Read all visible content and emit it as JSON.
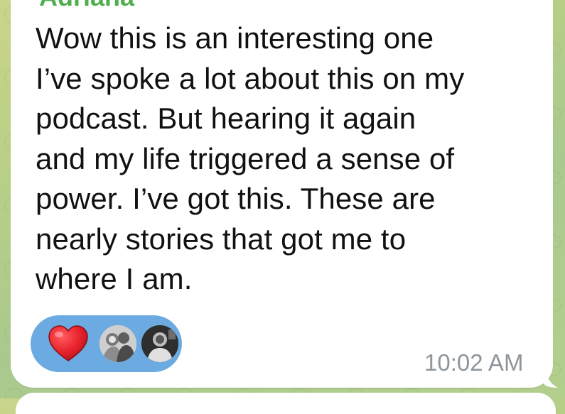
{
  "chat": {
    "sender_name": "Adriana",
    "message_lines": [
      "Wow this is an interesting one",
      "I’ve spoke a lot about this on my",
      "podcast. But hearing it again",
      "and my life triggered a sense of",
      "power. I’ve got this. These are",
      "nearly stories that got me to",
      "where I am."
    ],
    "timestamp": "10:02 AM",
    "reactions": {
      "emoji_icon": "red-heart-icon",
      "reactor_avatars": [
        "avatar-reactor-1",
        "avatar-reactor-2"
      ]
    }
  },
  "colors": {
    "sender_name": "#4fae4e",
    "reaction_pill": "#6cabe2",
    "heart": "#e8222b",
    "timestamp": "#8e959b",
    "bubble": "#ffffff"
  }
}
